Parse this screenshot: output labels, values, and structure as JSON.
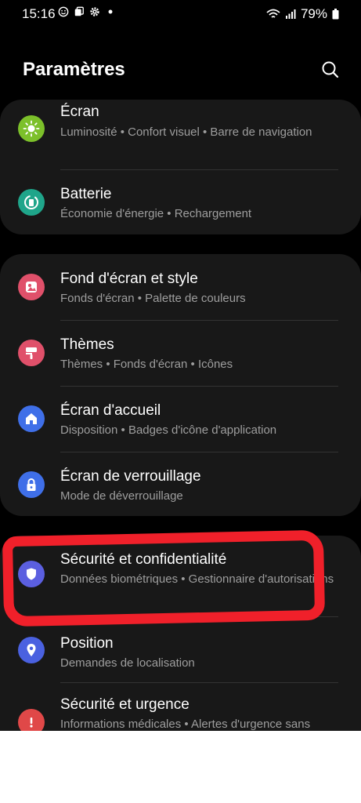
{
  "status_bar": {
    "time": "15:16",
    "battery": "79%"
  },
  "header": {
    "title": "Paramètres"
  },
  "groups": [
    {
      "items": [
        {
          "title": "Écran",
          "subtitle": "Luminosité • Confort visuel • Barre de navigation",
          "icon": "sun-icon",
          "color": "#7cc02a"
        },
        {
          "title": "Batterie",
          "subtitle": "Économie d'énergie • Rechargement",
          "icon": "battery-icon",
          "color": "#1fa58a"
        }
      ]
    },
    {
      "items": [
        {
          "title": "Fond d'écran et style",
          "subtitle": "Fonds d'écran • Palette de couleurs",
          "icon": "image-icon",
          "color": "#e0506a"
        },
        {
          "title": "Thèmes",
          "subtitle": "Thèmes • Fonds d'écran • Icônes",
          "icon": "brush-icon",
          "color": "#e0506a"
        },
        {
          "title": "Écran d'accueil",
          "subtitle": "Disposition • Badges d'icône d'application",
          "icon": "home-icon",
          "color": "#3f6fe8"
        },
        {
          "title": "Écran de verrouillage",
          "subtitle": "Mode de déverrouillage",
          "icon": "lock-icon",
          "color": "#3f6fe8"
        }
      ]
    },
    {
      "items": [
        {
          "title": "Sécurité et confidentialité",
          "subtitle": "Données biométriques • Gestionnaire d'autorisations",
          "icon": "shield-icon",
          "color": "#5b5fe0"
        },
        {
          "title": "Position",
          "subtitle": "Demandes de localisation",
          "icon": "location-pin-icon",
          "color": "#4a61e0"
        },
        {
          "title": "Sécurité et urgence",
          "subtitle": "Informations médicales • Alertes d'urgence sans",
          "icon": "emergency-icon",
          "color": "#e04848"
        }
      ]
    }
  ]
}
